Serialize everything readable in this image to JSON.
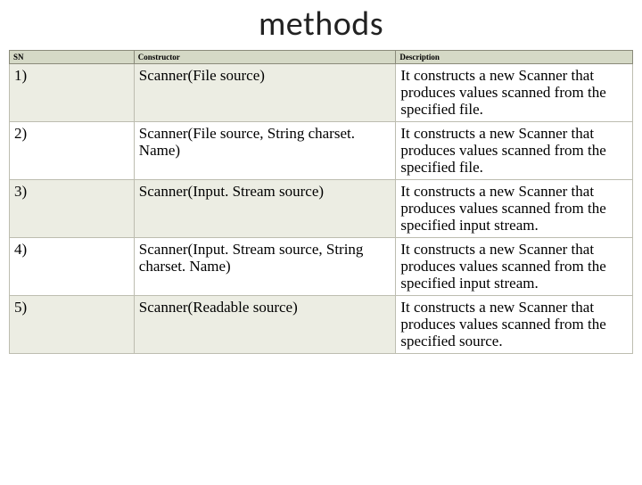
{
  "title": "methods",
  "headers": {
    "sn": "SN",
    "constructor": "Constructor",
    "description": "Description"
  },
  "rows": [
    {
      "sn": "1)",
      "constructor": "Scanner(File source)",
      "description": "It constructs a new Scanner that produces values scanned from the specified file."
    },
    {
      "sn": "2)",
      "constructor": "Scanner(File source, String charset. Name)",
      "description": "It constructs a new Scanner that produces values scanned from the specified file."
    },
    {
      "sn": "3)",
      "constructor": "Scanner(Input. Stream source)",
      "description": "It constructs a new Scanner that produces values scanned from the specified input stream."
    },
    {
      "sn": "4)",
      "constructor": "Scanner(Input. Stream source, String charset. Name)",
      "description": "It constructs a new Scanner that produces values scanned from the specified input stream."
    },
    {
      "sn": "5)",
      "constructor": "Scanner(Readable source)",
      "description": "It constructs a new Scanner that produces values scanned from the specified source."
    }
  ]
}
